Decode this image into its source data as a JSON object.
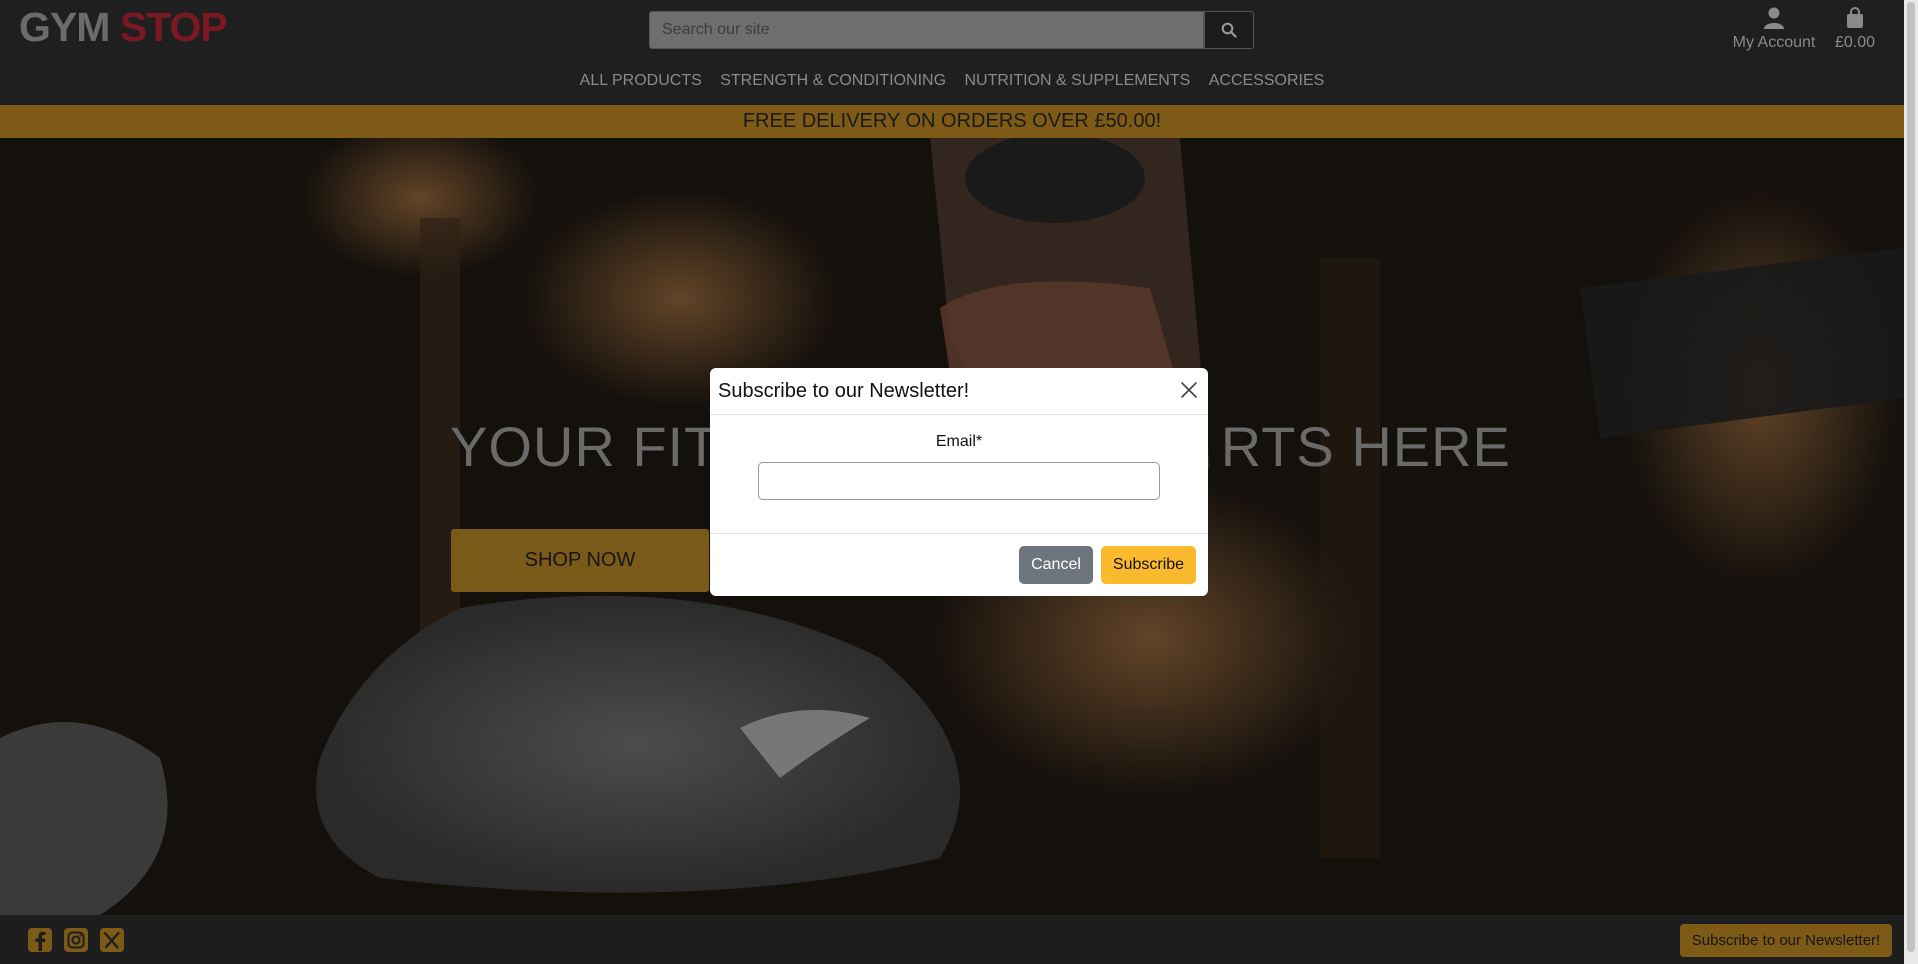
{
  "header": {
    "logo_part1": "GYM",
    "logo_part2": "STOP",
    "search_placeholder": "Search our site",
    "account_label": "My Account",
    "cart_total": "£0.00",
    "icons": {
      "search": "search-icon",
      "account": "user-icon",
      "cart": "shopping-bag-icon"
    }
  },
  "nav": {
    "items": [
      {
        "label": "ALL PRODUCTS"
      },
      {
        "label": "STRENGTH & CONDITIONING"
      },
      {
        "label": "NUTRITION & SUPPLEMENTS"
      },
      {
        "label": "ACCESSORIES"
      }
    ]
  },
  "banner": {
    "text": "FREE DELIVERY ON ORDERS OVER £50.00!"
  },
  "hero": {
    "title_left": "YOUR FITN",
    "title_right": "RTS HERE",
    "button_label": "SHOP NOW"
  },
  "modal": {
    "title": "Subscribe to our Newsletter!",
    "email_label": "Email*",
    "email_value": "",
    "cancel_label": "Cancel",
    "subscribe_label": "Subscribe"
  },
  "footer": {
    "social": [
      "facebook-icon",
      "instagram-icon",
      "x-icon"
    ],
    "newsletter_button": "Subscribe to our Newsletter!"
  },
  "colors": {
    "accent": "#7d5a16",
    "brand_red": "#7a1823",
    "subscribe_yellow": "#fbb92e",
    "cancel_grey": "#6c757d"
  }
}
